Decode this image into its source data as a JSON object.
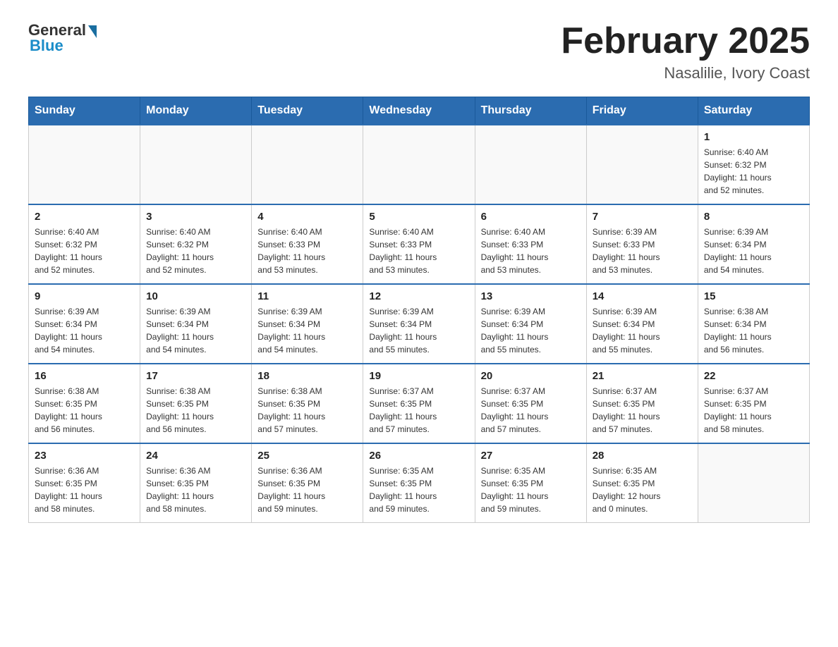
{
  "header": {
    "logo_general": "General",
    "logo_blue": "Blue",
    "title": "February 2025",
    "location": "Nasalilie, Ivory Coast"
  },
  "weekdays": [
    "Sunday",
    "Monday",
    "Tuesday",
    "Wednesday",
    "Thursday",
    "Friday",
    "Saturday"
  ],
  "weeks": [
    [
      {
        "day": "",
        "info": ""
      },
      {
        "day": "",
        "info": ""
      },
      {
        "day": "",
        "info": ""
      },
      {
        "day": "",
        "info": ""
      },
      {
        "day": "",
        "info": ""
      },
      {
        "day": "",
        "info": ""
      },
      {
        "day": "1",
        "info": "Sunrise: 6:40 AM\nSunset: 6:32 PM\nDaylight: 11 hours\nand 52 minutes."
      }
    ],
    [
      {
        "day": "2",
        "info": "Sunrise: 6:40 AM\nSunset: 6:32 PM\nDaylight: 11 hours\nand 52 minutes."
      },
      {
        "day": "3",
        "info": "Sunrise: 6:40 AM\nSunset: 6:32 PM\nDaylight: 11 hours\nand 52 minutes."
      },
      {
        "day": "4",
        "info": "Sunrise: 6:40 AM\nSunset: 6:33 PM\nDaylight: 11 hours\nand 53 minutes."
      },
      {
        "day": "5",
        "info": "Sunrise: 6:40 AM\nSunset: 6:33 PM\nDaylight: 11 hours\nand 53 minutes."
      },
      {
        "day": "6",
        "info": "Sunrise: 6:40 AM\nSunset: 6:33 PM\nDaylight: 11 hours\nand 53 minutes."
      },
      {
        "day": "7",
        "info": "Sunrise: 6:39 AM\nSunset: 6:33 PM\nDaylight: 11 hours\nand 53 minutes."
      },
      {
        "day": "8",
        "info": "Sunrise: 6:39 AM\nSunset: 6:34 PM\nDaylight: 11 hours\nand 54 minutes."
      }
    ],
    [
      {
        "day": "9",
        "info": "Sunrise: 6:39 AM\nSunset: 6:34 PM\nDaylight: 11 hours\nand 54 minutes."
      },
      {
        "day": "10",
        "info": "Sunrise: 6:39 AM\nSunset: 6:34 PM\nDaylight: 11 hours\nand 54 minutes."
      },
      {
        "day": "11",
        "info": "Sunrise: 6:39 AM\nSunset: 6:34 PM\nDaylight: 11 hours\nand 54 minutes."
      },
      {
        "day": "12",
        "info": "Sunrise: 6:39 AM\nSunset: 6:34 PM\nDaylight: 11 hours\nand 55 minutes."
      },
      {
        "day": "13",
        "info": "Sunrise: 6:39 AM\nSunset: 6:34 PM\nDaylight: 11 hours\nand 55 minutes."
      },
      {
        "day": "14",
        "info": "Sunrise: 6:39 AM\nSunset: 6:34 PM\nDaylight: 11 hours\nand 55 minutes."
      },
      {
        "day": "15",
        "info": "Sunrise: 6:38 AM\nSunset: 6:34 PM\nDaylight: 11 hours\nand 56 minutes."
      }
    ],
    [
      {
        "day": "16",
        "info": "Sunrise: 6:38 AM\nSunset: 6:35 PM\nDaylight: 11 hours\nand 56 minutes."
      },
      {
        "day": "17",
        "info": "Sunrise: 6:38 AM\nSunset: 6:35 PM\nDaylight: 11 hours\nand 56 minutes."
      },
      {
        "day": "18",
        "info": "Sunrise: 6:38 AM\nSunset: 6:35 PM\nDaylight: 11 hours\nand 57 minutes."
      },
      {
        "day": "19",
        "info": "Sunrise: 6:37 AM\nSunset: 6:35 PM\nDaylight: 11 hours\nand 57 minutes."
      },
      {
        "day": "20",
        "info": "Sunrise: 6:37 AM\nSunset: 6:35 PM\nDaylight: 11 hours\nand 57 minutes."
      },
      {
        "day": "21",
        "info": "Sunrise: 6:37 AM\nSunset: 6:35 PM\nDaylight: 11 hours\nand 57 minutes."
      },
      {
        "day": "22",
        "info": "Sunrise: 6:37 AM\nSunset: 6:35 PM\nDaylight: 11 hours\nand 58 minutes."
      }
    ],
    [
      {
        "day": "23",
        "info": "Sunrise: 6:36 AM\nSunset: 6:35 PM\nDaylight: 11 hours\nand 58 minutes."
      },
      {
        "day": "24",
        "info": "Sunrise: 6:36 AM\nSunset: 6:35 PM\nDaylight: 11 hours\nand 58 minutes."
      },
      {
        "day": "25",
        "info": "Sunrise: 6:36 AM\nSunset: 6:35 PM\nDaylight: 11 hours\nand 59 minutes."
      },
      {
        "day": "26",
        "info": "Sunrise: 6:35 AM\nSunset: 6:35 PM\nDaylight: 11 hours\nand 59 minutes."
      },
      {
        "day": "27",
        "info": "Sunrise: 6:35 AM\nSunset: 6:35 PM\nDaylight: 11 hours\nand 59 minutes."
      },
      {
        "day": "28",
        "info": "Sunrise: 6:35 AM\nSunset: 6:35 PM\nDaylight: 12 hours\nand 0 minutes."
      },
      {
        "day": "",
        "info": ""
      }
    ]
  ]
}
